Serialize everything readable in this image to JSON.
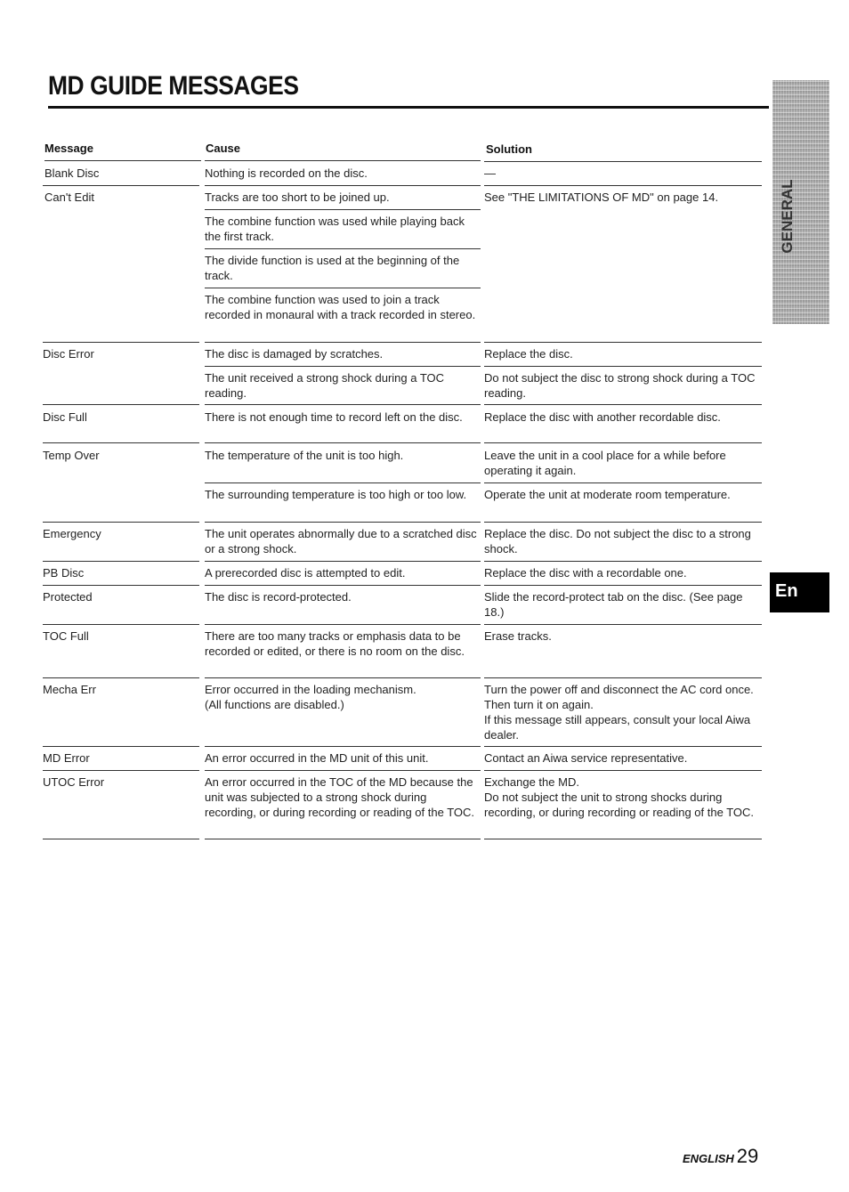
{
  "page": {
    "title": "MD GUIDE MESSAGES",
    "side_tab_label": "GENERAL",
    "language_tab": "En",
    "footer_language": "ENGLISH",
    "page_number": "29"
  },
  "table": {
    "headers": {
      "message": "Message",
      "cause": "Cause",
      "solution": "Solution"
    },
    "rows": [
      {
        "message": "Blank Disc",
        "entries": [
          {
            "cause": "Nothing is recorded on the disc.",
            "solution": "—"
          }
        ]
      },
      {
        "message": "Can't Edit",
        "entries": [
          {
            "cause": "Tracks are too short to be joined up.",
            "solution": "See \"THE LIMITATIONS OF MD\" on page 14."
          },
          {
            "cause": "The combine function was used while playing back the first track.",
            "solution": ""
          },
          {
            "cause": "The divide function is used at the beginning of the track.",
            "solution": ""
          },
          {
            "cause": "The combine function was used to join a track recorded in monaural with a track recorded in stereo.",
            "solution": ""
          }
        ]
      },
      {
        "message": "Disc Error",
        "entries": [
          {
            "cause": "The disc is damaged by scratches.",
            "solution": "Replace the disc."
          },
          {
            "cause": "The unit received a strong shock during a TOC reading.",
            "solution": "Do not subject the disc to strong shock during a TOC reading."
          }
        ]
      },
      {
        "message": "Disc Full",
        "entries": [
          {
            "cause": "There is not enough time to record left on the disc.",
            "solution": "Replace the disc with another recordable disc."
          }
        ]
      },
      {
        "message": "Temp Over",
        "entries": [
          {
            "cause": "The temperature of the unit is too high.",
            "solution": "Leave the unit in a cool place for a while before operating it again."
          },
          {
            "cause": "The surrounding temperature is too high or too low.",
            "solution": "Operate the unit at moderate room temperature."
          }
        ]
      },
      {
        "message": "Emergency",
        "entries": [
          {
            "cause": "The unit operates abnormally due to a scratched disc or a strong shock.",
            "solution": "Replace the disc. Do not subject the disc to a strong shock."
          }
        ]
      },
      {
        "message": "PB Disc",
        "entries": [
          {
            "cause": "A prerecorded disc is attempted to edit.",
            "solution": "Replace the disc with a recordable one."
          }
        ]
      },
      {
        "message": "Protected",
        "entries": [
          {
            "cause": "The disc is record-protected.",
            "solution": "Slide the record-protect tab on the disc. (See page 18.)"
          }
        ]
      },
      {
        "message": "TOC Full",
        "entries": [
          {
            "cause": "There are too many tracks or emphasis data to be recorded or edited, or there is no room on the disc.",
            "solution": "Erase tracks."
          }
        ]
      },
      {
        "message": "Mecha Err",
        "entries": [
          {
            "cause": "Error occurred in the loading mechanism.\n(All functions are disabled.)",
            "solution": "Turn the power off and disconnect the AC cord once. Then turn it on again.\nIf this message still appears, consult your local Aiwa dealer."
          }
        ]
      },
      {
        "message": "MD Error",
        "entries": [
          {
            "cause": "An error occurred in the MD unit of this unit.",
            "solution": "Contact an Aiwa service representative."
          }
        ]
      },
      {
        "message": "UTOC Error",
        "entries": [
          {
            "cause": "An error occurred in the TOC of the MD because the unit was subjected to a strong shock during recording, or during recording or reading of the TOC.",
            "solution": "Exchange the MD.\nDo not subject the unit to strong shocks during recording, or during recording or reading of the TOC."
          }
        ]
      }
    ]
  }
}
